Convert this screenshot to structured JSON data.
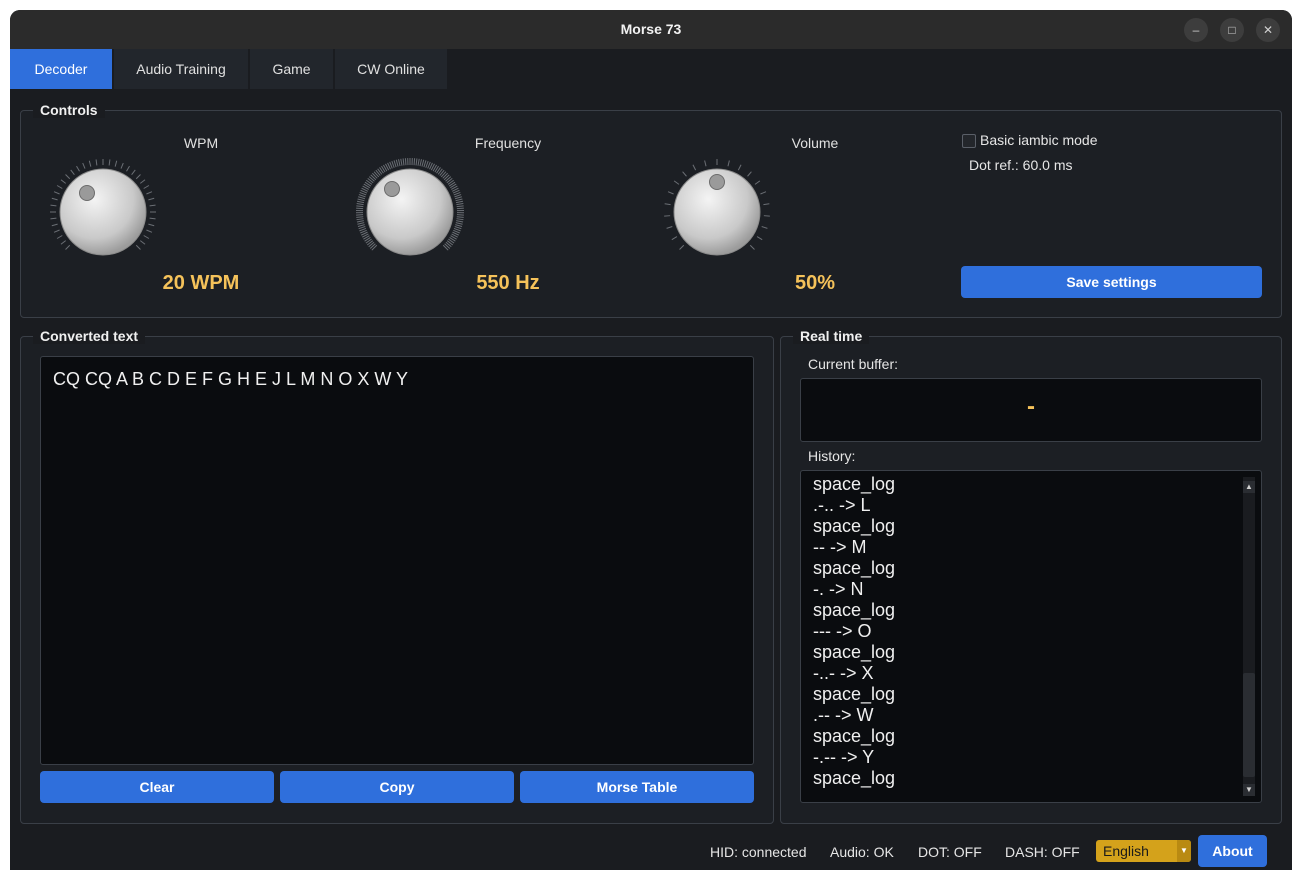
{
  "window": {
    "title": "Morse 73"
  },
  "tabs": [
    {
      "label": "Decoder",
      "active": true
    },
    {
      "label": "Audio Training",
      "active": false
    },
    {
      "label": "Game",
      "active": false
    },
    {
      "label": "CW Online",
      "active": false
    }
  ],
  "controls": {
    "title": "Controls",
    "knobs": [
      {
        "label": "WPM",
        "value": "20 WPM",
        "level": 0.15
      },
      {
        "label": "Frequency",
        "value": "550 Hz",
        "level": 0.2
      },
      {
        "label": "Volume",
        "value": "50%",
        "level": 0.5
      }
    ],
    "iambic_label": "Basic iambic mode",
    "iambic_checked": false,
    "dot_ref": "Dot ref.: 60.0 ms",
    "save_label": "Save settings"
  },
  "converted": {
    "title": "Converted text",
    "text": "CQ CQ A B C D E F G H E J L M N O X W Y",
    "clear_label": "Clear",
    "copy_label": "Copy",
    "table_label": "Morse Table"
  },
  "realtime": {
    "title": "Real time",
    "buffer_label": "Current buffer:",
    "buffer_value": "-",
    "history_label": "History:",
    "history": [
      "space_log",
      ".-.. -> L",
      "space_log",
      "-- -> M",
      "space_log",
      "-. -> N",
      "space_log",
      "--- -> O",
      "space_log",
      "-..- -> X",
      "space_log",
      ".-- -> W",
      "space_log",
      "-.-- -> Y",
      "space_log"
    ]
  },
  "status": {
    "hid": "HID: connected",
    "audio": "Audio: OK",
    "dot": "DOT: OFF",
    "dash": "DASH: OFF",
    "language": "English",
    "about_label": "About"
  },
  "colors": {
    "accent": "#2f6fdc",
    "value": "#f5c25a",
    "language_combo": "#d4a21b"
  }
}
